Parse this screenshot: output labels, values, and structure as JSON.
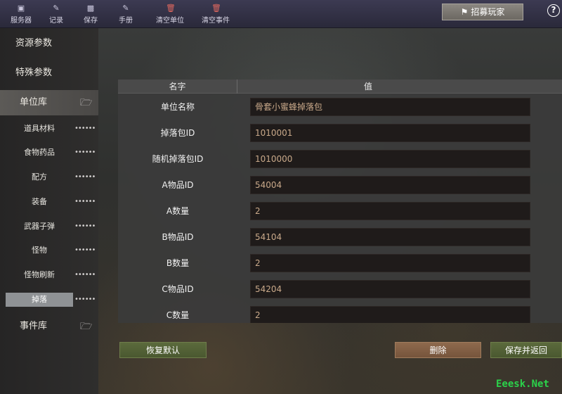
{
  "toolbar": {
    "items": [
      {
        "label": "服务器",
        "icon": "server-icon"
      },
      {
        "label": "记录",
        "icon": "record-icon"
      },
      {
        "label": "保存",
        "icon": "save-icon"
      },
      {
        "label": "手册",
        "icon": "manual-icon"
      },
      {
        "label": "清空单位",
        "icon": "trash-icon"
      },
      {
        "label": "清空事件",
        "icon": "trash-icon"
      }
    ],
    "recruit_label": "招募玩家",
    "help_label": "?"
  },
  "sidebar": {
    "resource_params": "资源参数",
    "special_params": "特殊参数",
    "unit_library": "单位库",
    "items": [
      {
        "label": "道具材料",
        "dots": "••••••"
      },
      {
        "label": "食物药品",
        "dots": "••••••"
      },
      {
        "label": "配方",
        "dots": "••••••"
      },
      {
        "label": "装备",
        "dots": "••••••"
      },
      {
        "label": "武器子弹",
        "dots": "••••••"
      },
      {
        "label": "怪物",
        "dots": "••••••"
      },
      {
        "label": "怪物刷新",
        "dots": "••••••"
      },
      {
        "label": "掉落",
        "dots": "••••••"
      }
    ],
    "event_library": "事件库"
  },
  "table": {
    "col_name": "名字",
    "col_value": "值",
    "rows": [
      {
        "key": "单位名称",
        "value": "骨套小蜜蜂掉落包"
      },
      {
        "key": "掉落包ID",
        "value": "1010001"
      },
      {
        "key": "随机掉落包ID",
        "value": "1010000"
      },
      {
        "key": "A物品ID",
        "value": "54004"
      },
      {
        "key": "A数量",
        "value": "2"
      },
      {
        "key": "B物品ID",
        "value": "54104"
      },
      {
        "key": "B数量",
        "value": "2"
      },
      {
        "key": "C物品ID",
        "value": "54204"
      },
      {
        "key": "C数量",
        "value": "2"
      }
    ]
  },
  "buttons": {
    "restore": "恢复默认",
    "delete": "删除",
    "save_return": "保存并返回"
  },
  "watermark": "Eeesk.Net",
  "colors": {
    "toolbar_bg": "#2e2d40",
    "panel_bg": "#3a3a3a",
    "value_text": "#c9a98a",
    "green_button": "#5b6a3c",
    "brown_button": "#8e6a4d",
    "selected_item": "#8f9295"
  }
}
